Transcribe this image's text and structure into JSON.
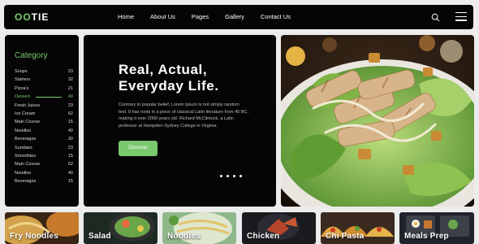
{
  "brand": {
    "logo_accent": "OO",
    "logo_rest": "TIE"
  },
  "nav": {
    "links": [
      "Home",
      "About Us",
      "Pages",
      "Gallery",
      "Contact Us"
    ]
  },
  "icons": {
    "search": "search-icon",
    "menu": "hamburger-menu-icon"
  },
  "sidebar": {
    "title": "Category",
    "items": [
      {
        "label": "Soups",
        "count": "23"
      },
      {
        "label": "Starters",
        "count": "32"
      },
      {
        "label": "Pizza's",
        "count": "21"
      },
      {
        "label": "Dessert",
        "count": "40"
      },
      {
        "label": "Fresh Juices",
        "count": "23"
      },
      {
        "label": "Ice Cream",
        "count": "62"
      },
      {
        "label": "Main Course",
        "count": "15"
      },
      {
        "label": "Noodles",
        "count": "40"
      },
      {
        "label": "Beverages",
        "count": "30"
      },
      {
        "label": "Sundaes",
        "count": "23"
      },
      {
        "label": "Smoothies",
        "count": "15"
      },
      {
        "label": "Main Course",
        "count": "62"
      },
      {
        "label": "Noodles",
        "count": "40"
      },
      {
        "label": "Beverages",
        "count": "15"
      }
    ],
    "active_item": "Dessert"
  },
  "hero": {
    "title_line1": "Real, Actual,",
    "title_line2": "Everyday Life.",
    "description": "Contrary to popular belief, Lorem Ipsum is not simply random text. It has roots in a piece of classical Latin literature from 45 BC, making it over 2000 years old. Richard McClintock, a Latin professor at Hampden-Sydney College in Virginia.",
    "button_label": "Discover",
    "slide_count": 4
  },
  "categories_strip": [
    {
      "label": "Fry Noodles"
    },
    {
      "label": "Salad"
    },
    {
      "label": "Noodles"
    },
    {
      "label": "Chicken"
    },
    {
      "label": "Chi Pasta"
    },
    {
      "label": "Meals Prep"
    }
  ],
  "colors": {
    "accent": "#7bc96f",
    "panel": "#050505",
    "background": "#ececec"
  }
}
